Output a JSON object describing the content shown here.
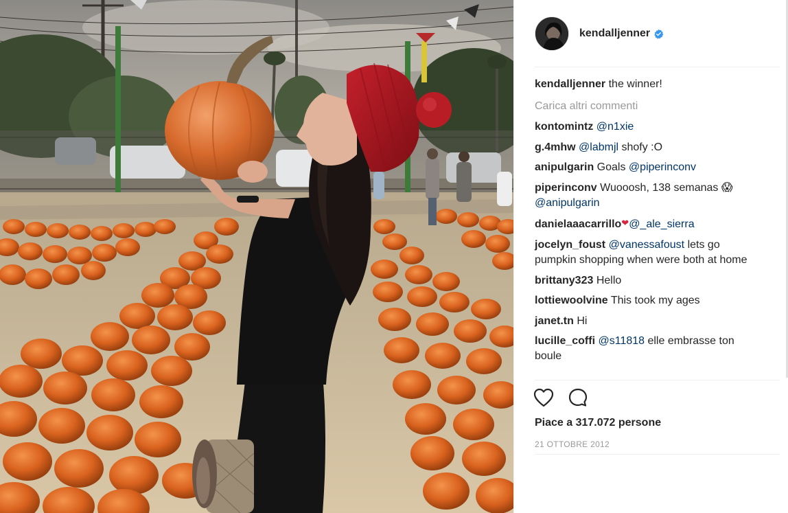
{
  "post": {
    "author": "kendalljenner",
    "verified_icon": "verified-badge-icon",
    "caption_user": "kendalljenner",
    "caption_text": " the winner!",
    "load_more": "Carica altri commenti",
    "comments": [
      {
        "user": "kontomintz",
        "text": " ",
        "mention": "@n1xie",
        "after": ""
      },
      {
        "user": "g.4mhw",
        "text": " ",
        "mention": "@labmjl",
        "after": " shofy :O"
      },
      {
        "user": "anipulgarin",
        "text": " Goals ",
        "mention": "@piperinconv",
        "after": ""
      },
      {
        "user": "piperinconv",
        "text": " Wuooosh, 138 semanas 😱",
        "mention": "@anipulgarin",
        "after": ""
      },
      {
        "user": "danielaaacarrillo",
        "text": "❤",
        "mention": "@_ale_sierra",
        "after": ""
      },
      {
        "user": "jocelyn_foust",
        "text": " ",
        "mention": "@vanessafoust",
        "after": " lets go pumpkin shopping when were both at home"
      },
      {
        "user": "brittany323",
        "text": " Hello",
        "mention": "",
        "after": ""
      },
      {
        "user": "lottiewoolvine",
        "text": " This took my ages",
        "mention": "",
        "after": ""
      },
      {
        "user": "janet.tn",
        "text": " Hi",
        "mention": "",
        "after": ""
      },
      {
        "user": "lucille_coffi",
        "text": " ",
        "mention": "@s11818",
        "after": " elle embrasse ton boule"
      }
    ],
    "likes": "Piace a 317.072 persone",
    "date": "21 OTTOBRE 2012",
    "icons": {
      "like": "heart-icon",
      "comment": "comment-icon"
    }
  },
  "colors": {
    "mention": "#003569",
    "muted": "#999999",
    "verified": "#3897f0",
    "text": "#262626"
  }
}
